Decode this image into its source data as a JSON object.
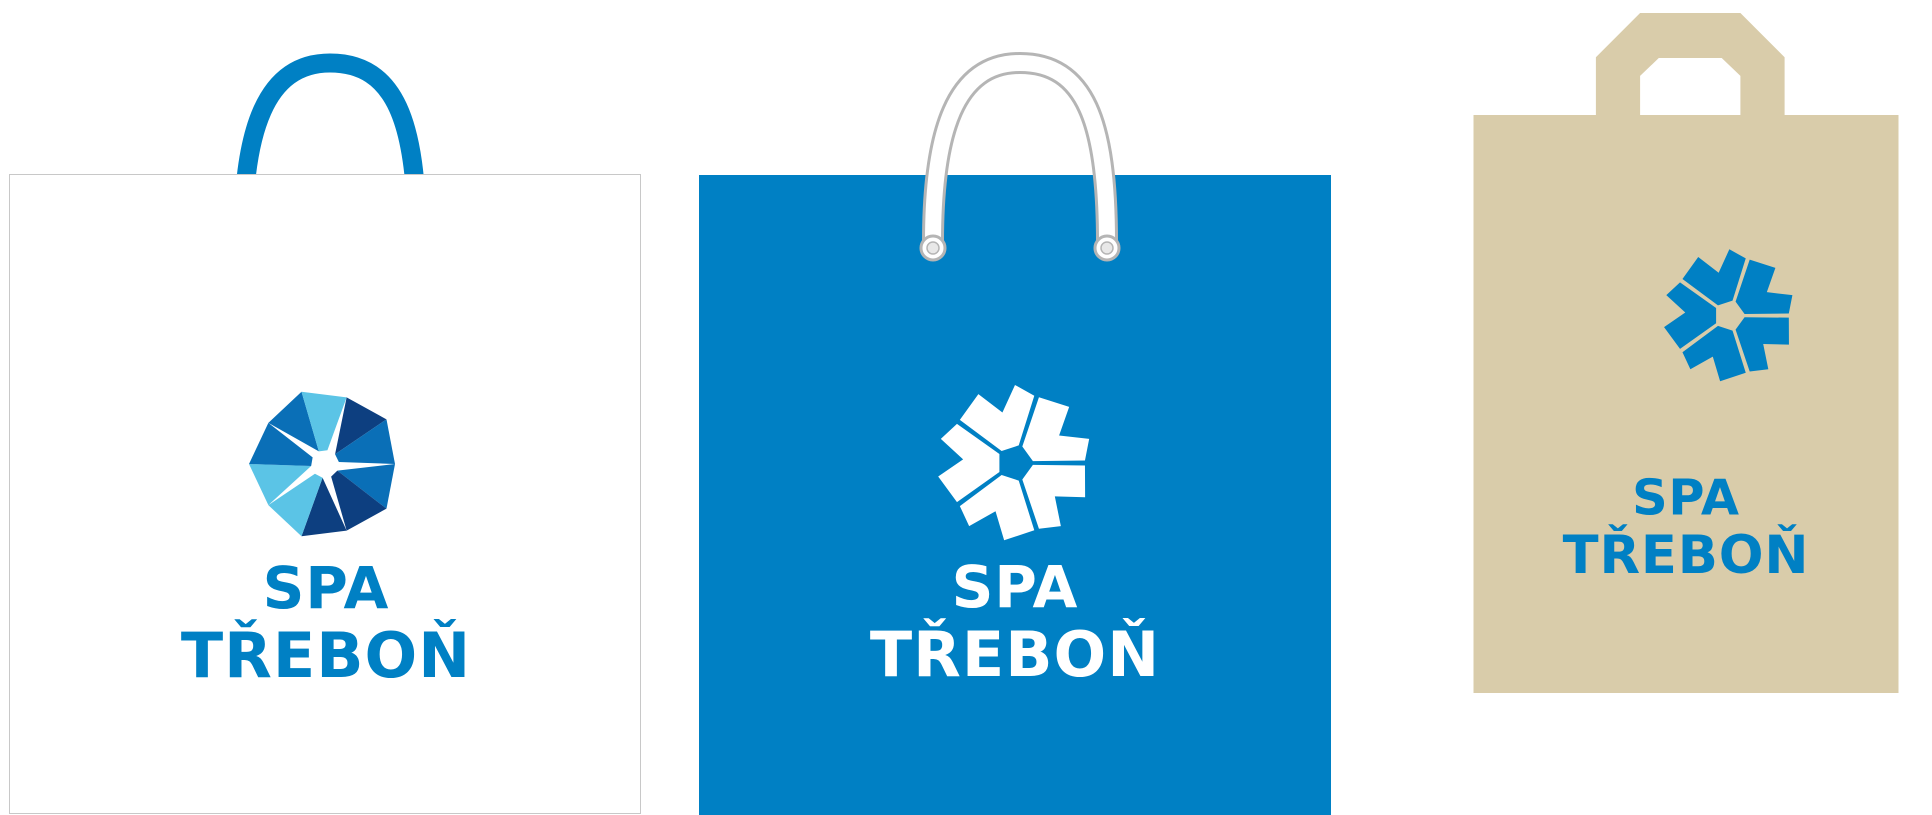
{
  "brand": {
    "line1": "SPA",
    "line2": "TŘEBOŇ"
  },
  "colors": {
    "brand_blue": "#0080c4",
    "kraft": "#d9ccaa",
    "white": "#ffffff",
    "outline_gray": "#c8c8c8",
    "petal_light": "#5bc4e6",
    "petal_mid": "#0a6fb7",
    "petal_dark": "#0d3f80"
  },
  "bags": [
    {
      "id": "white-bag",
      "handle": "blue-rope-handle",
      "logo": "multicolor-flower-logo"
    },
    {
      "id": "blue-bag",
      "handle": "white-rope-handle",
      "logo": "white-flower-logo"
    },
    {
      "id": "kraft-bag",
      "handle": "die-cut-handle",
      "logo": "blue-flower-logo"
    }
  ]
}
